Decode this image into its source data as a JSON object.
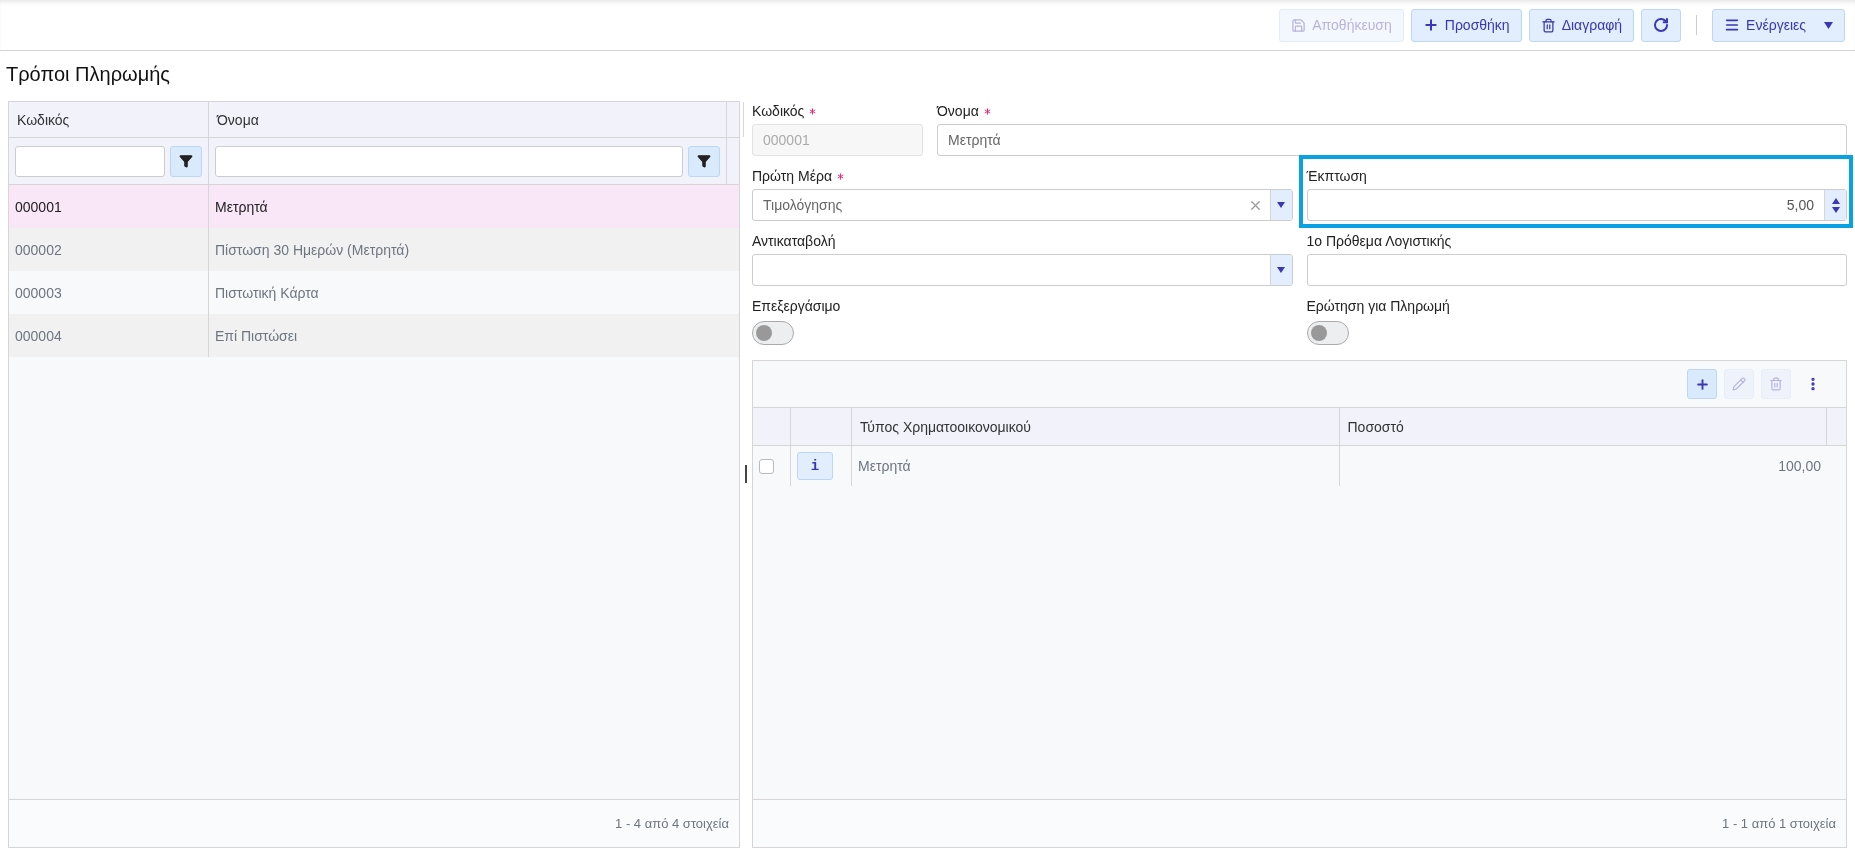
{
  "toolbar": {
    "buttons": [
      {
        "kind": "save",
        "label": "Αποθήκευση",
        "disabled": true
      },
      {
        "kind": "add",
        "label": "Προσθήκη",
        "disabled": false
      },
      {
        "kind": "delete",
        "label": "Διαγραφή",
        "disabled": false
      },
      {
        "kind": "refresh",
        "disabled": false
      },
      {
        "kind": "actions",
        "label": "Ενέργειες",
        "disabled": false
      }
    ]
  },
  "page_title": "Τρόποι Πληρωμής",
  "list": {
    "columns": [
      "Κωδικός",
      "Όνομα"
    ],
    "rows": [
      {
        "code": "000001",
        "name": "Μετρητά",
        "selected": true
      },
      {
        "code": "000002",
        "name": "Πίστωση 30 Ημερών (Μετρητά)",
        "selected": false
      },
      {
        "code": "000003",
        "name": "Πιστωτική Κάρτα",
        "selected": false
      },
      {
        "code": "000004",
        "name": "Επί Πιστώσει",
        "selected": false
      }
    ],
    "pager": "1 - 4 από 4 στοιχεία"
  },
  "form": {
    "rows": [
      [
        {
          "kind": "text",
          "label": "Κωδικός",
          "required": true,
          "value": "000001",
          "disabled": true
        },
        {
          "kind": "text",
          "label": "Όνομα",
          "required": true,
          "value": "Μετρητά",
          "disabled": false
        }
      ],
      [
        {
          "kind": "select",
          "label": "Πρώτη Μέρα",
          "required": true,
          "value": "Τιμολόγησης"
        },
        {
          "kind": "number",
          "label": "Έκπτωση",
          "required": false,
          "value": "5,00",
          "highlighted": true
        }
      ],
      [
        {
          "kind": "select",
          "label": "Αντικαταβολή",
          "required": false
        },
        {
          "kind": "text",
          "label": "1ο Πρόθεμα Λογιστικής",
          "required": false,
          "disabled": false
        }
      ],
      [
        {
          "kind": "toggle",
          "label": "Επεξεργάσιμο",
          "on": false
        },
        {
          "kind": "toggle",
          "label": "Ερώτηση για Πληρωμή",
          "on": false
        }
      ]
    ]
  },
  "details": {
    "tools": [
      {
        "kind": "add",
        "disabled": false
      },
      {
        "kind": "edit",
        "disabled": true
      },
      {
        "kind": "delete",
        "disabled": true
      },
      {
        "kind": "more",
        "disabled": false
      }
    ],
    "columns": [
      "Τύπος Χρηματοοικονομικού",
      "Ποσοστό"
    ],
    "rows": [
      {
        "checked": false,
        "info": "i",
        "type": "Μετρητά",
        "percent": "100,00"
      }
    ],
    "pager": "1 - 1 από 1 στοιχεία"
  }
}
